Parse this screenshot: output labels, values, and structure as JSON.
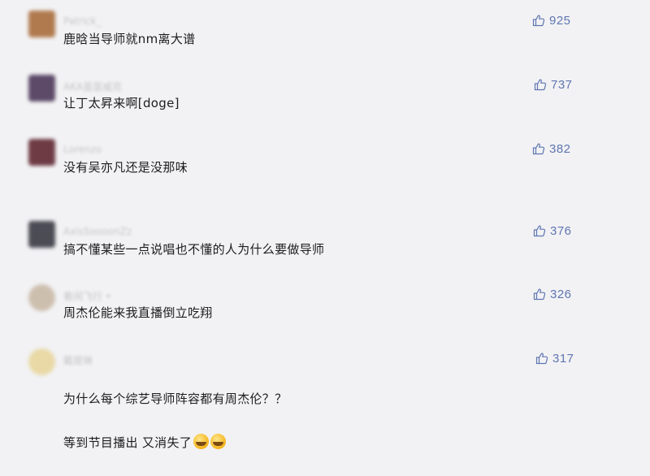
{
  "comments": [
    {
      "username": "Patrick_",
      "text": "鹿晗当导师就nm离大谱",
      "likes": "925",
      "avatar_color": "#b07a4e"
    },
    {
      "username": "AKA苗苗威克",
      "text": "让丁太昇来啊[doge]",
      "likes": "737",
      "avatar_color": "#5c4a68"
    },
    {
      "username": "Lorenzo",
      "text": "没有吴亦凡还是没那味",
      "likes": "382",
      "avatar_color": "#6e3b44"
    },
    {
      "username": "AxisSoooonZz",
      "text": "搞不懂某些一点说唱也不懂的人为什么要做导师",
      "likes": "376",
      "avatar_color": "#4c4c55"
    },
    {
      "username": "看闲飞行 •",
      "text": "周杰伦能来我直播倒立吃翔",
      "likes": "326",
      "avatar_color": "#cdbfae"
    },
    {
      "username": "戴提琳",
      "text_line1": "为什么每个综艺导师阵容都有周杰伦？？",
      "text_line2": "等到节目播出 又消失了",
      "likes": "317",
      "avatar_color": "#e9d9a6"
    }
  ],
  "like_icon": "thumbs-up-icon",
  "emoji_icon": "laughing-tears-emoji",
  "colors": {
    "background": "#f2f2f4",
    "like": "#5f76b2",
    "text": "#1d1d1f"
  }
}
